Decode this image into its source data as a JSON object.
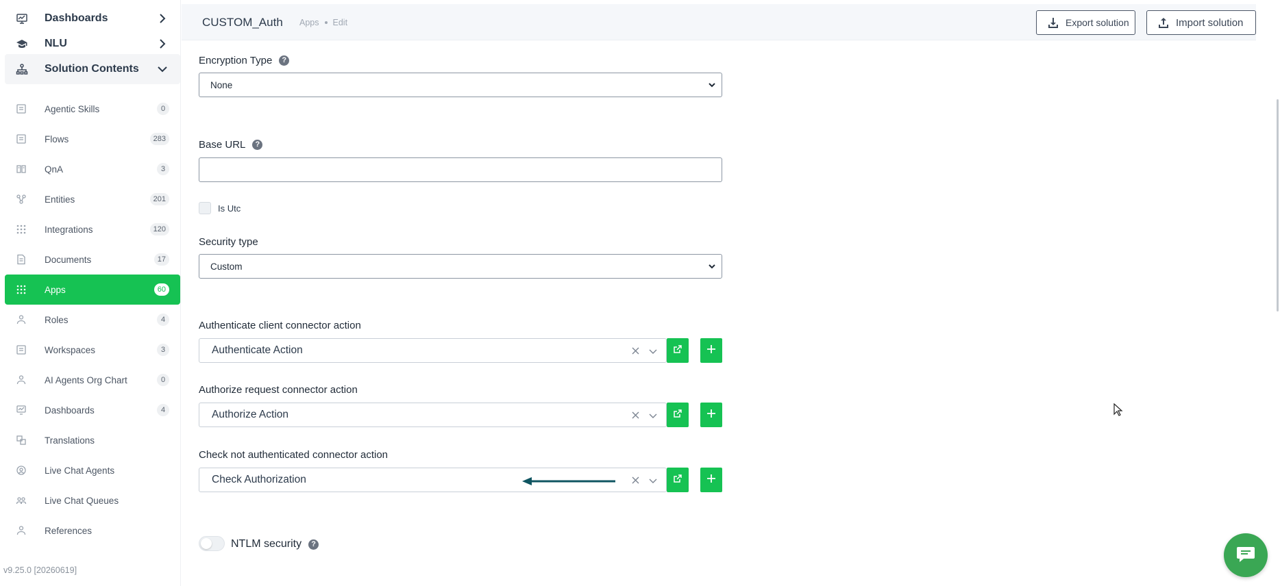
{
  "sidebar": {
    "sections": [
      {
        "label": "Dashboards",
        "icon": "chart-board-icon",
        "expanded": false
      },
      {
        "label": "NLU",
        "icon": "graduation-cap-icon",
        "expanded": false
      },
      {
        "label": "Solution Contents",
        "icon": "sitemap-icon",
        "expanded": true
      }
    ],
    "items": [
      {
        "label": "Agentic Skills",
        "count": "0",
        "icon": "list-icon"
      },
      {
        "label": "Flows",
        "count": "283",
        "icon": "flow-icon"
      },
      {
        "label": "QnA",
        "count": "3",
        "icon": "book-icon"
      },
      {
        "label": "Entities",
        "count": "201",
        "icon": "entities-icon"
      },
      {
        "label": "Integrations",
        "count": "120",
        "icon": "grid-dots-icon"
      },
      {
        "label": "Documents",
        "count": "17",
        "icon": "document-icon"
      },
      {
        "label": "Apps",
        "count": "60",
        "icon": "apps-icon",
        "active": true
      },
      {
        "label": "Roles",
        "count": "4",
        "icon": "roles-icon"
      },
      {
        "label": "Workspaces",
        "count": "3",
        "icon": "workspace-icon"
      },
      {
        "label": "AI Agents Org Chart",
        "count": "0",
        "icon": "org-chart-icon"
      },
      {
        "label": "Dashboards",
        "count": "4",
        "icon": "dashboard-icon"
      },
      {
        "label": "Translations",
        "count": "",
        "icon": "translate-icon"
      },
      {
        "label": "Live Chat Agents",
        "count": "",
        "icon": "agent-icon"
      },
      {
        "label": "Live Chat Queues",
        "count": "",
        "icon": "queue-icon"
      },
      {
        "label": "References",
        "count": "",
        "icon": "reference-icon"
      }
    ],
    "version": "v9.25.0 [20260619]"
  },
  "header": {
    "title": "CUSTOM_Auth",
    "breadcrumb": [
      "Apps",
      "Edit"
    ],
    "export_label": "Export solution",
    "import_label": "Import solution"
  },
  "form": {
    "encryption_label": "Encryption Type",
    "encryption_value": "None",
    "base_url_label": "Base URL",
    "base_url_value": "",
    "is_utc_label": "Is Utc",
    "is_utc_checked": false,
    "security_type_label": "Security type",
    "security_type_value": "Custom",
    "authenticate_label": "Authenticate client connector action",
    "authenticate_value": "Authenticate Action",
    "authorize_label": "Authorize request connector action",
    "authorize_value": "Authorize Action",
    "check_label": "Check not authenticated connector action",
    "check_value": "Check Authorization",
    "ntlm_label": "NTLM security",
    "ntlm_enabled": false
  },
  "colors": {
    "accent": "#16c253",
    "chat_fab": "#3aa754",
    "annotation_arrow": "#0f5561"
  }
}
